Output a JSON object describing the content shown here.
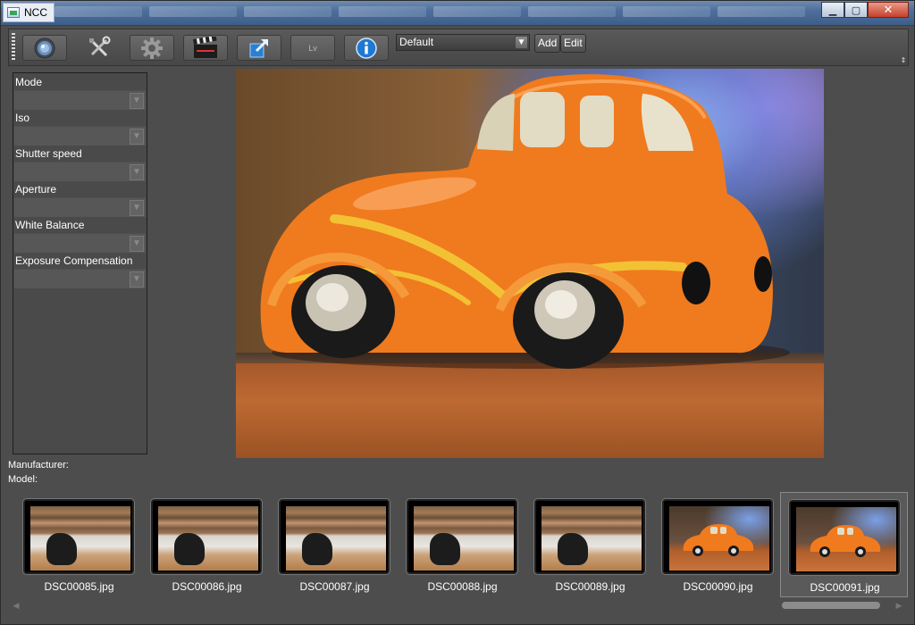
{
  "window": {
    "title": "NCC",
    "minimize_glyph": "▁",
    "maximize_glyph": "▢",
    "close_glyph": "✕"
  },
  "toolbar": {
    "buttons": [
      {
        "name": "capture-button",
        "icon": "lens-icon"
      },
      {
        "name": "tools-button",
        "icon": "wrench-screwdriver-icon"
      },
      {
        "name": "settings-button",
        "icon": "gear-icon"
      },
      {
        "name": "movie-button",
        "icon": "clapperboard-icon"
      },
      {
        "name": "fullscreen-button",
        "icon": "expand-arrow-icon"
      },
      {
        "name": "liveview-button",
        "label": "Lv"
      },
      {
        "name": "info-button",
        "icon": "info-icon"
      }
    ],
    "profile_value": "Default",
    "add_label": "Add",
    "edit_label": "Edit",
    "overflow_glyph": "⇕"
  },
  "settings": [
    {
      "label": "Mode",
      "value": ""
    },
    {
      "label": "Iso",
      "value": ""
    },
    {
      "label": "Shutter speed",
      "value": ""
    },
    {
      "label": "Aperture",
      "value": ""
    },
    {
      "label": "White Balance",
      "value": ""
    },
    {
      "label": "Exposure Compensation",
      "value": ""
    }
  ],
  "info": {
    "manufacturer_label": "Manufacturer:",
    "manufacturer_value": "",
    "model_label": "Model:",
    "model_value": ""
  },
  "thumbnails": [
    {
      "file": "DSC00085.jpg",
      "kind": "desk",
      "selected": false
    },
    {
      "file": "DSC00086.jpg",
      "kind": "desk",
      "selected": false
    },
    {
      "file": "DSC00087.jpg",
      "kind": "desk",
      "selected": false
    },
    {
      "file": "DSC00088.jpg",
      "kind": "desk",
      "selected": false
    },
    {
      "file": "DSC00089.jpg",
      "kind": "desk",
      "selected": false
    },
    {
      "file": "DSC00090.jpg",
      "kind": "car",
      "selected": false
    },
    {
      "file": "DSC00091.jpg",
      "kind": "car",
      "selected": true
    }
  ],
  "colors": {
    "background": "#4d4d4d",
    "car_orange": "#f07a1e",
    "car_stripe": "#f2c234",
    "info_blue": "#1f78d1"
  }
}
